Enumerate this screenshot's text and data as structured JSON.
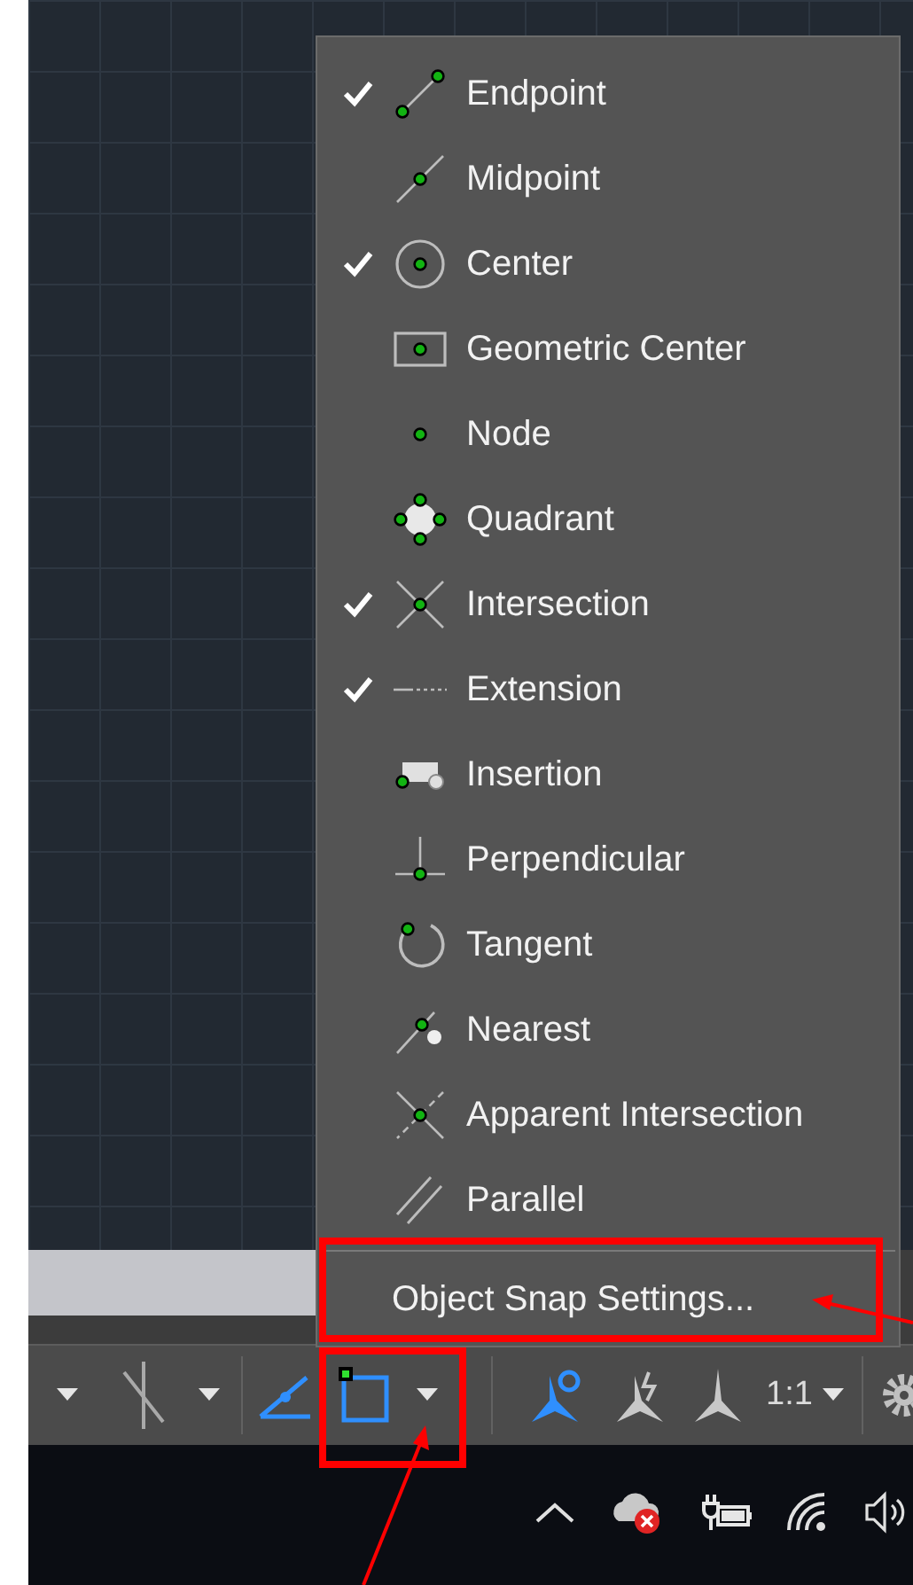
{
  "osnap_menu": {
    "items": [
      {
        "label": "Endpoint",
        "checked": true
      },
      {
        "label": "Midpoint",
        "checked": false
      },
      {
        "label": "Center",
        "checked": true
      },
      {
        "label": "Geometric Center",
        "checked": false
      },
      {
        "label": "Node",
        "checked": false
      },
      {
        "label": "Quadrant",
        "checked": false
      },
      {
        "label": "Intersection",
        "checked": true
      },
      {
        "label": "Extension",
        "checked": true
      },
      {
        "label": "Insertion",
        "checked": false
      },
      {
        "label": "Perpendicular",
        "checked": false
      },
      {
        "label": "Tangent",
        "checked": false
      },
      {
        "label": "Nearest",
        "checked": false
      },
      {
        "label": "Apparent Intersection",
        "checked": false
      },
      {
        "label": "Parallel",
        "checked": false
      }
    ],
    "settings": "Object Snap Settings..."
  },
  "status_bar": {
    "scale": "1:1"
  }
}
